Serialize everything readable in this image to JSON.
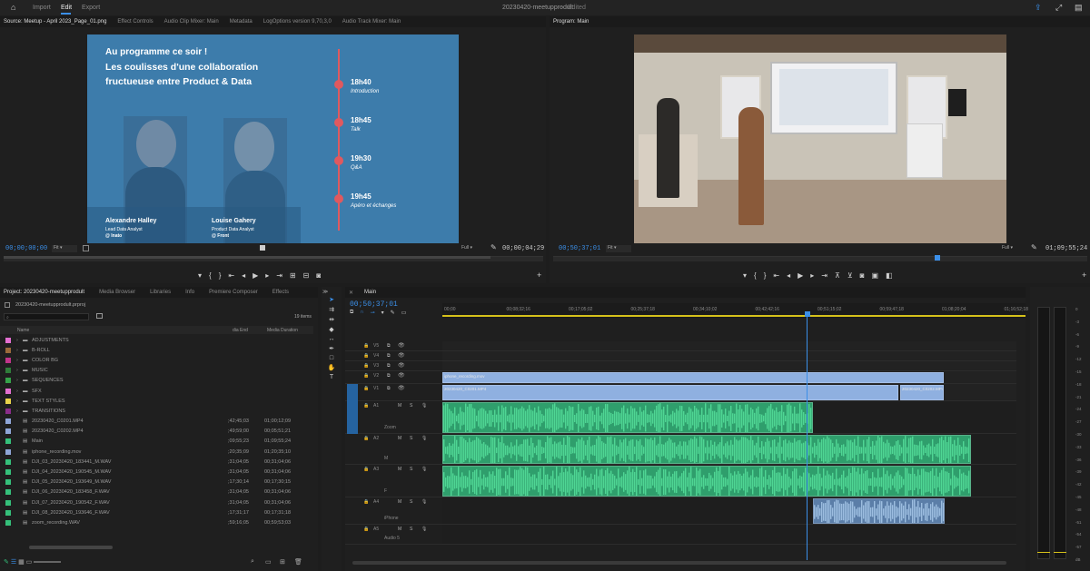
{
  "header": {
    "nav": [
      "Import",
      "Edit",
      "Export"
    ],
    "active": "Edit",
    "project_title": "20230420-meetupprodult",
    "status": "Edited"
  },
  "source": {
    "tabs": [
      "Source: Meetup - April 2023_Page_01.png",
      "Effect Controls",
      "Audio Clip Mixer: Main",
      "Metadata",
      "LogOptions version 9,70,3,0",
      "Audio Track Mixer: Main"
    ],
    "timecode_in": "00;00;00;00",
    "fit": "Fit",
    "full": "Full",
    "timecode_out": "00;00;04;29"
  },
  "slide": {
    "heading": "Au programme ce soir !",
    "title_line1": "Les coulisses d'une collaboration",
    "title_line2": "fructueuse entre Product & Data",
    "agenda": [
      {
        "time": "18h40",
        "label": "Introduction"
      },
      {
        "time": "18h45",
        "label": "Talk"
      },
      {
        "time": "19h30",
        "label": "Q&A"
      },
      {
        "time": "19h45",
        "label": "Apéro et échanges"
      }
    ],
    "speakers": [
      {
        "name": "Alexandre Halley",
        "role": "Lead Data Analyst",
        "company": "@ Inato"
      },
      {
        "name": "Louise Gahery",
        "role": "Product Data Analyst",
        "company": "@ Front"
      }
    ]
  },
  "program": {
    "tab": "Program: Main",
    "timecode_in": "00;50;37;01",
    "fit": "Fit",
    "full": "Full",
    "timecode_out": "01;09;55;24"
  },
  "project": {
    "tabs": [
      "Project: 20230420-meetupprodult",
      "Media Browser",
      "Libraries",
      "Info",
      "Premiere Composer",
      "Effects"
    ],
    "file": "20230420-meetupprodult.prproj",
    "count": "19 items",
    "columns": [
      "Name",
      "dia End",
      "Media Duration"
    ],
    "items": [
      {
        "name": "ADJUSTMENTS",
        "color": "#e36fd1",
        "end": "",
        "dur": ""
      },
      {
        "name": "B-ROLL",
        "color": "#9a6a3a",
        "end": "",
        "dur": ""
      },
      {
        "name": "COLOR BG",
        "color": "#c0348a",
        "end": "",
        "dur": ""
      },
      {
        "name": "MUSIC",
        "color": "#2f7d3a",
        "end": "",
        "dur": ""
      },
      {
        "name": "SEQUENCES",
        "color": "#35a34a",
        "end": "",
        "dur": ""
      },
      {
        "name": "SFX",
        "color": "#e36fd1",
        "end": "",
        "dur": ""
      },
      {
        "name": "TEXT STYLES",
        "color": "#e8d24a",
        "end": "",
        "dur": ""
      },
      {
        "name": "TRANSITIONS",
        "color": "#8a2c8a",
        "end": "",
        "dur": ""
      },
      {
        "name": "20230420_C0201.MP4",
        "color": "#8fa6d8",
        "end": ";42;45;03",
        "dur": "01;00;12;09"
      },
      {
        "name": "20230420_C0202.MP4",
        "color": "#8fa6d8",
        "end": ";49;59;00",
        "dur": "00;05;51;21"
      },
      {
        "name": "Main",
        "color": "#35c07a",
        "end": ";09;55;23",
        "dur": "01;09;55;24"
      },
      {
        "name": "iphone_recording.mov",
        "color": "#8fa6d8",
        "end": ";20;35;09",
        "dur": "01;20;35;10"
      },
      {
        "name": "DJI_03_20230420_183441_M.WAV",
        "color": "#35c07a",
        "end": ";31;04;05",
        "dur": "00;31;04;06"
      },
      {
        "name": "DJI_04_20230420_190545_M.WAV",
        "color": "#35c07a",
        "end": ";31;04;05",
        "dur": "00;31;04;06"
      },
      {
        "name": "DJI_05_20230420_193649_M.WAV",
        "color": "#35c07a",
        "end": ";17;30;14",
        "dur": "00;17;30;15"
      },
      {
        "name": "DJI_06_20230420_183458_F.WAV",
        "color": "#35c07a",
        "end": ";31;04;05",
        "dur": "00;31;04;06"
      },
      {
        "name": "DJI_07_20230420_190542_F.WAV",
        "color": "#35c07a",
        "end": ";31;04;05",
        "dur": "00;31;04;06"
      },
      {
        "name": "DJI_08_20230420_193646_F.WAV",
        "color": "#35c07a",
        "end": ";17;31;17",
        "dur": "00;17;31;18"
      },
      {
        "name": "zoom_recording.WAV",
        "color": "#35c07a",
        "end": ";59;16;05",
        "dur": "00;59;53;03"
      }
    ]
  },
  "timeline": {
    "tab": "Main",
    "timecode": "00;50;37;01",
    "ruler": [
      "00;00",
      "00;08;32;16",
      "00;17;05;02",
      "00;25;37;18",
      "00;34;10;02",
      "00;42;42;16",
      "00;51;15;02",
      "00;59;47;18",
      "01;08;20;04",
      "01;16;52;18"
    ],
    "tracks": [
      "V5",
      "V4",
      "V3",
      "V2",
      "V1",
      "A1",
      "A2",
      "A3",
      "A4",
      "A5"
    ],
    "track_names": {
      "A1": "Zoom",
      "A2": "M",
      "A3": "F",
      "A4": "iPhone",
      "A5": "Audio 5"
    },
    "clips": {
      "v2": "iphone_recording.mov",
      "v1a": "20230420_C0201.MP4",
      "v1b": "20230420_C0202.MP4"
    }
  },
  "meter": [
    "0",
    "-3",
    "-6",
    "-9",
    "-12",
    "-15",
    "-18",
    "-21",
    "-24",
    "-27",
    "-30",
    "-33",
    "-36",
    "-39",
    "-42",
    "-45",
    "-48",
    "-51",
    "-54",
    "-57",
    "dB"
  ]
}
